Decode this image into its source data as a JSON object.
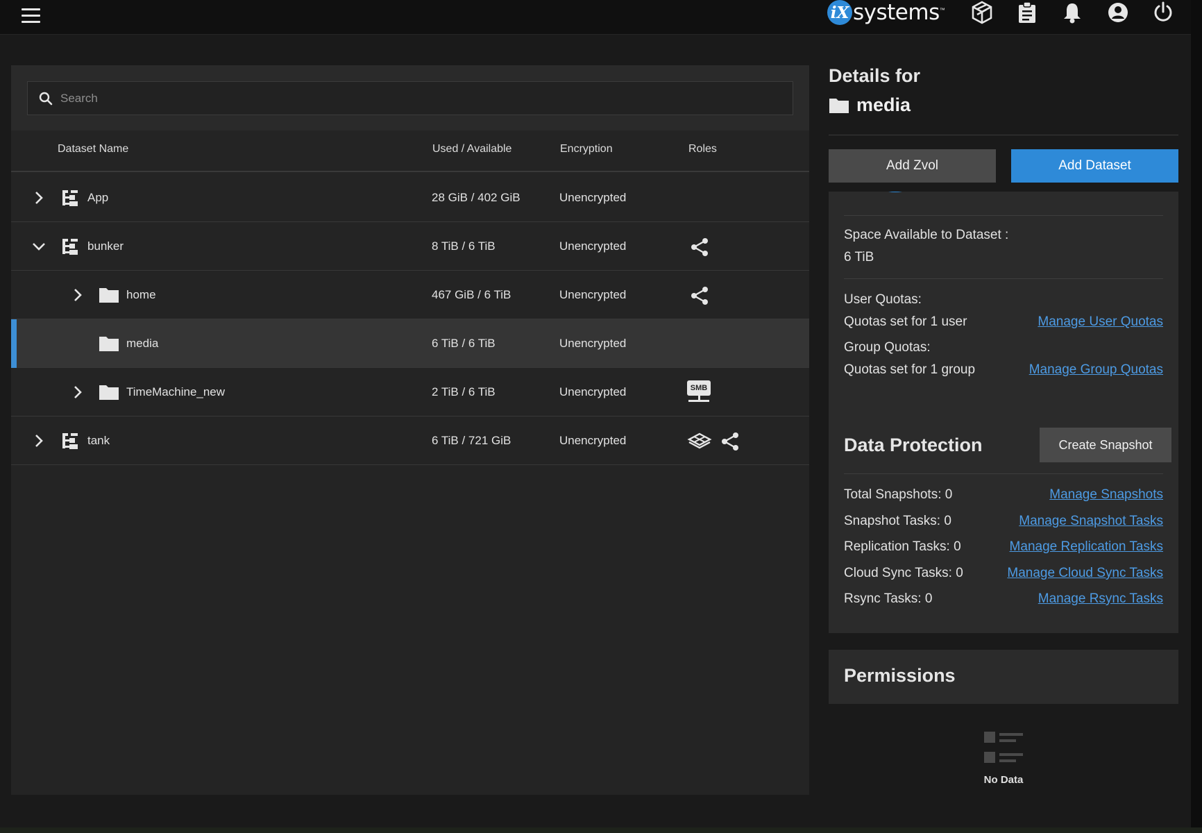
{
  "topbar": {
    "logo_mark": "iX",
    "logo_text": "systems",
    "logo_tm": "™"
  },
  "search": {
    "placeholder": "Search"
  },
  "table": {
    "headers": {
      "name": "Dataset Name",
      "used": "Used / Available",
      "encryption": "Encryption",
      "roles": "Roles"
    },
    "rows": [
      {
        "name": "App",
        "used": "28 GiB / 402 GiB",
        "encryption": "Unencrypted",
        "expand": "collapsed",
        "icon": "pool-tree-icon",
        "level": 0,
        "roles": []
      },
      {
        "name": "bunker",
        "used": "8 TiB / 6 TiB",
        "encryption": "Unencrypted",
        "expand": "expanded",
        "icon": "pool-tree-icon",
        "level": 0,
        "roles": [
          "share-icon"
        ]
      },
      {
        "name": "home",
        "used": "467 GiB / 6 TiB",
        "encryption": "Unencrypted",
        "expand": "collapsed",
        "icon": "folder-icon",
        "level": 1,
        "roles": [
          "share-icon"
        ]
      },
      {
        "name": "media",
        "used": "6 TiB / 6 TiB",
        "encryption": "Unencrypted",
        "expand": "none",
        "icon": "folder-icon",
        "level": 1,
        "roles": [],
        "selected": true
      },
      {
        "name": "TimeMachine_new",
        "used": "2 TiB / 6 TiB",
        "encryption": "Unencrypted",
        "expand": "collapsed",
        "icon": "folder-icon",
        "level": 1,
        "roles": [
          "smb-icon"
        ],
        "smb_label": "SMB"
      },
      {
        "name": "tank",
        "used": "6 TiB / 721 GiB",
        "encryption": "Unencrypted",
        "expand": "collapsed",
        "icon": "pool-tree-icon",
        "level": 0,
        "roles": [
          "apps-icon",
          "share-icon"
        ]
      }
    ]
  },
  "details": {
    "title": "Details for",
    "dataset_name": "media",
    "add_zvol": "Add Zvol",
    "add_dataset": "Add Dataset"
  },
  "space_card": {
    "space_label": "Space Available to Dataset :",
    "space_value": "6 TiB",
    "user_quotas_label": "User Quotas:",
    "user_quotas_value": "Quotas set for 1 user",
    "manage_user_quotas": "Manage User Quotas",
    "group_quotas_label": "Group Quotas:",
    "group_quotas_value": "Quotas set for 1 group",
    "manage_group_quotas": "Manage Group Quotas"
  },
  "data_protection": {
    "title": "Data Protection",
    "create_snapshot": "Create Snapshot",
    "items": [
      {
        "label": "Total Snapshots:",
        "value": "0",
        "link": "Manage Snapshots"
      },
      {
        "label": "Snapshot Tasks:",
        "value": "0",
        "link": "Manage Snapshot Tasks"
      },
      {
        "label": "Replication Tasks:",
        "value": "0",
        "link": "Manage Replication Tasks"
      },
      {
        "label": "Cloud Sync Tasks:",
        "value": "0",
        "link": "Manage Cloud Sync Tasks"
      },
      {
        "label": "Rsync Tasks:",
        "value": "0",
        "link": "Manage Rsync Tasks"
      }
    ]
  },
  "permissions": {
    "title": "Permissions",
    "no_data": "No Data"
  },
  "colors": {
    "accent": "#2e8ad8",
    "link": "#4d9be4",
    "selected_bar": "#3d8fd6"
  }
}
